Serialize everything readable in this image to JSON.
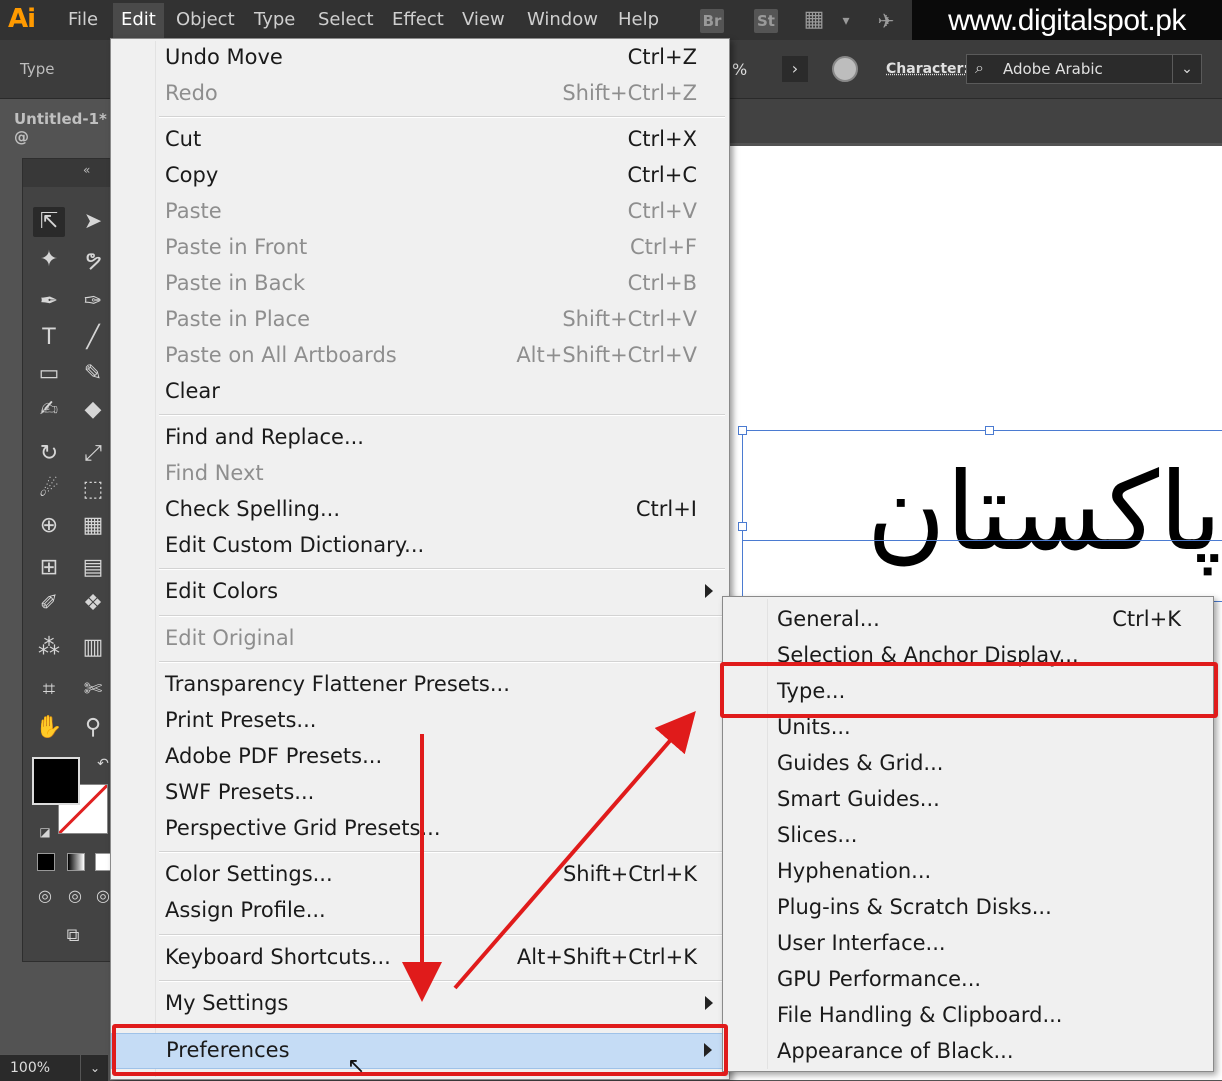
{
  "menubar": {
    "logo": "Ai",
    "items": [
      "File",
      "Edit",
      "Object",
      "Type",
      "Select",
      "Effect",
      "View",
      "Window",
      "Help"
    ],
    "bridge_label": "Br",
    "stock_label": "St"
  },
  "watermark": "www.digitalspot.pk",
  "controlbar": {
    "tool_name": "Type",
    "percent": "%",
    "character_label": "Character:",
    "font_name": "Adobe Arabic"
  },
  "document": {
    "tab_title": "Untitled-1* @",
    "sample_text": "پاکستان"
  },
  "zoom": "100%",
  "edit_menu": {
    "items": [
      {
        "label": "Undo Move",
        "shortcut": "Ctrl+Z",
        "enabled": true
      },
      {
        "label": "Redo",
        "shortcut": "Shift+Ctrl+Z",
        "enabled": false
      },
      {
        "label": "Cut",
        "shortcut": "Ctrl+X",
        "enabled": true
      },
      {
        "label": "Copy",
        "shortcut": "Ctrl+C",
        "enabled": true
      },
      {
        "label": "Paste",
        "shortcut": "Ctrl+V",
        "enabled": false
      },
      {
        "label": "Paste in Front",
        "shortcut": "Ctrl+F",
        "enabled": false
      },
      {
        "label": "Paste in Back",
        "shortcut": "Ctrl+B",
        "enabled": false
      },
      {
        "label": "Paste in Place",
        "shortcut": "Shift+Ctrl+V",
        "enabled": false
      },
      {
        "label": "Paste on All Artboards",
        "shortcut": "Alt+Shift+Ctrl+V",
        "enabled": false
      },
      {
        "label": "Clear",
        "shortcut": "",
        "enabled": true
      },
      {
        "label": "Find and Replace...",
        "shortcut": "",
        "enabled": true
      },
      {
        "label": "Find Next",
        "shortcut": "",
        "enabled": false
      },
      {
        "label": "Check Spelling...",
        "shortcut": "Ctrl+I",
        "enabled": true
      },
      {
        "label": "Edit Custom Dictionary...",
        "shortcut": "",
        "enabled": true
      },
      {
        "label": "Edit Colors",
        "shortcut": "",
        "enabled": true
      },
      {
        "label": "Edit Original",
        "shortcut": "",
        "enabled": false
      },
      {
        "label": "Transparency Flattener Presets...",
        "shortcut": "",
        "enabled": true
      },
      {
        "label": "Print Presets...",
        "shortcut": "",
        "enabled": true
      },
      {
        "label": "Adobe PDF Presets...",
        "shortcut": "",
        "enabled": true
      },
      {
        "label": "SWF Presets...",
        "shortcut": "",
        "enabled": true
      },
      {
        "label": "Perspective Grid Presets...",
        "shortcut": "",
        "enabled": true
      },
      {
        "label": "Color Settings...",
        "shortcut": "Shift+Ctrl+K",
        "enabled": true
      },
      {
        "label": "Assign Profile...",
        "shortcut": "",
        "enabled": true
      },
      {
        "label": "Keyboard Shortcuts...",
        "shortcut": "Alt+Shift+Ctrl+K",
        "enabled": true
      },
      {
        "label": "My Settings",
        "shortcut": "",
        "enabled": true
      },
      {
        "label": "Preferences",
        "shortcut": "",
        "enabled": true
      }
    ]
  },
  "preferences_menu": {
    "items": [
      {
        "label": "General...",
        "shortcut": "Ctrl+K"
      },
      {
        "label": "Selection & Anchor Display...",
        "shortcut": ""
      },
      {
        "label": "Type...",
        "shortcut": ""
      },
      {
        "label": "Units...",
        "shortcut": ""
      },
      {
        "label": "Guides & Grid...",
        "shortcut": ""
      },
      {
        "label": "Smart Guides...",
        "shortcut": ""
      },
      {
        "label": "Slices...",
        "shortcut": ""
      },
      {
        "label": "Hyphenation...",
        "shortcut": ""
      },
      {
        "label": "Plug-ins & Scratch Disks...",
        "shortcut": ""
      },
      {
        "label": "User Interface...",
        "shortcut": ""
      },
      {
        "label": "GPU Performance...",
        "shortcut": ""
      },
      {
        "label": "File Handling & Clipboard...",
        "shortcut": ""
      },
      {
        "label": "Appearance of Black...",
        "shortcut": ""
      }
    ]
  },
  "colors": {
    "highlight": "#e01b1b",
    "menu_selected": "#c5dcf5",
    "ai_brand": "#ff9a00"
  }
}
